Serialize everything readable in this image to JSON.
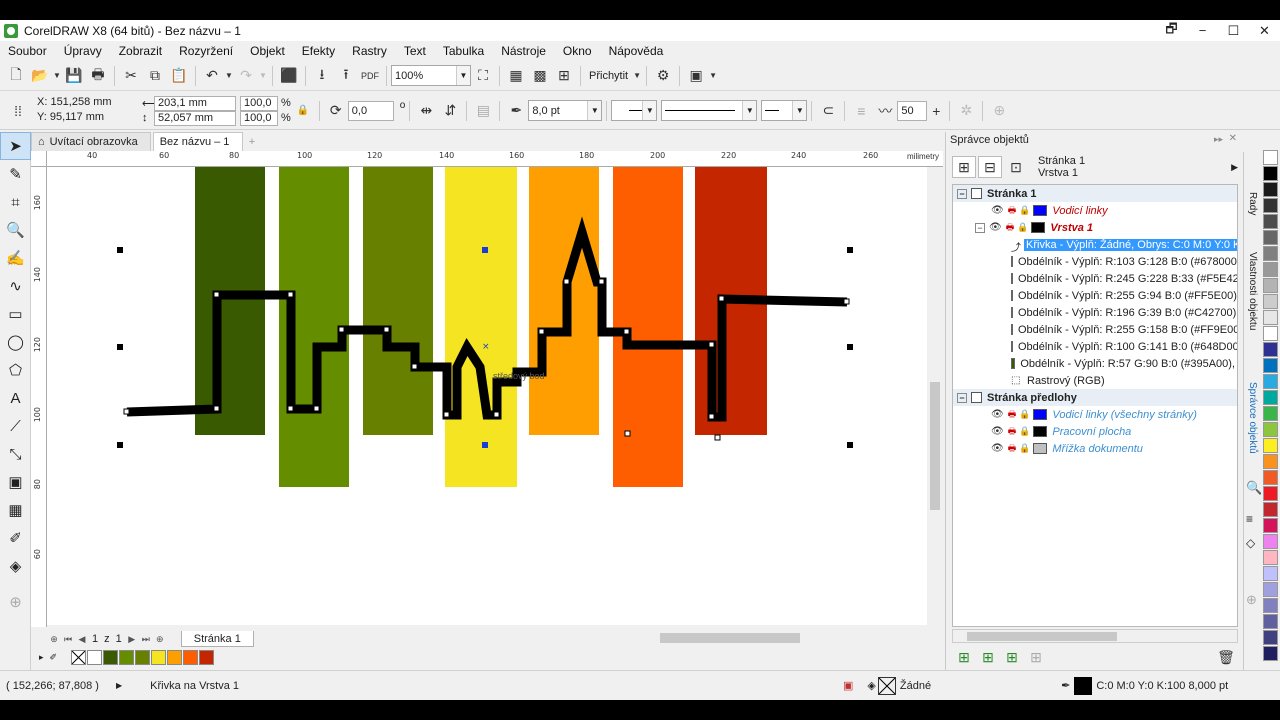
{
  "app": {
    "title": "CorelDRAW X8 (64 bitů) - Bez názvu – 1",
    "window_buttons": [
      "🗗",
      "−",
      "☐",
      "✕"
    ]
  },
  "menu": [
    "Soubor",
    "Úpravy",
    "Zobrazit",
    "Rozyržení",
    "Objekt",
    "Efekty",
    "Rastry",
    "Text",
    "Tabulka",
    "Nástroje",
    "Okno",
    "Nápověda"
  ],
  "toolbar1": {
    "zoom": "100%",
    "snap": "Přichytit",
    "pdf_label": "PDF"
  },
  "propbar": {
    "x": "X: 151,258 mm",
    "y": "Y: 95,117 mm",
    "w": "203,1 mm",
    "h": "52,057 mm",
    "sx": "100,0",
    "sy": "100,0",
    "pct": "%",
    "angle": "0,0",
    "deg": "o",
    "outline_width": "8,0 pt",
    "smooth": "50"
  },
  "tabs": {
    "welcome": "Uvítací obrazovka",
    "doc": "Bez názvu – 1",
    "add": "+"
  },
  "ruler": {
    "unit": "milimetry",
    "h_ticks": [
      "40",
      "60",
      "80",
      "100",
      "120",
      "140",
      "160",
      "180",
      "200",
      "220",
      "240",
      "260"
    ],
    "v_ticks": [
      "160",
      "140",
      "120",
      "100",
      "80",
      "60"
    ]
  },
  "canvas": {
    "node_label": "středový bod",
    "bars": [
      "#395A00",
      "#648D00",
      "#678000",
      "#F5E42",
      "#FF9E00",
      "#FF5E00",
      "#C42700"
    ]
  },
  "pagenav": {
    "current": "1",
    "of": "z",
    "total": "1",
    "tab": "Stránka 1"
  },
  "docpalette": [
    "#ffffff",
    "#395A00",
    "#648D00",
    "#678000",
    "#F5E421",
    "#FF9E00",
    "#FF5E00",
    "#C42700"
  ],
  "status": {
    "coords": "( 152,266; 87,808 )",
    "info": "Křivka na Vrstva 1",
    "fill": "Žádné",
    "outline": "C:0 M:0 Y:0 K:100  8,000 pt"
  },
  "docker": {
    "title": "Správce objektů",
    "page": "Stránka 1",
    "layer": "Vrstva 1",
    "tree": [
      {
        "level": 0,
        "type": "page",
        "text": "Stránka 1",
        "exp": "⊟"
      },
      {
        "level": 1,
        "type": "guides",
        "text": "Vodicí linky",
        "color": "#0000ff",
        "style": "ital red"
      },
      {
        "level": 1,
        "type": "layer",
        "text": "Vrstva 1",
        "color": "#000000",
        "style": "ital red bold",
        "exp": "⊟"
      },
      {
        "level": 2,
        "type": "curve",
        "text": "Křivka - Výplň: Žádné, Obrys: C:0 M:0 Y:0 K",
        "sel": true
      },
      {
        "level": 2,
        "type": "rect",
        "text": "Obdélník - Výplň: R:103 G:128 B:0 (#678000",
        "color": "#678000"
      },
      {
        "level": 2,
        "type": "rect",
        "text": "Obdélník - Výplň: R:245 G:228 B:33 (#F5E42",
        "color": "#F5E421"
      },
      {
        "level": 2,
        "type": "rect",
        "text": "Obdélník - Výplň: R:255 G:94 B:0 (#FF5E00),",
        "color": "#FF5E00"
      },
      {
        "level": 2,
        "type": "rect",
        "text": "Obdélník - Výplň: R:196 G:39 B:0 (#C42700)",
        "color": "#C42700"
      },
      {
        "level": 2,
        "type": "rect",
        "text": "Obdélník - Výplň: R:255 G:158 B:0 (#FF9E00",
        "color": "#FF9E00"
      },
      {
        "level": 2,
        "type": "rect",
        "text": "Obdélník - Výplň: R:100 G:141 B:0 (#648D00",
        "color": "#648D00"
      },
      {
        "level": 2,
        "type": "rect",
        "text": "Obdélník - Výplň: R:57 G:90 B:0 (#395A00),",
        "color": "#395A00"
      },
      {
        "level": 2,
        "type": "bitmap",
        "text": "Rastrový (RGB)"
      },
      {
        "level": 0,
        "type": "page",
        "text": "Stránka předlohy",
        "exp": "⊟"
      },
      {
        "level": 1,
        "type": "guides",
        "text": "Vodicí linky (všechny stránky)",
        "color": "#0000ff",
        "style": "ital blue"
      },
      {
        "level": 1,
        "type": "desk",
        "text": "Pracovní plocha",
        "color": "#000000",
        "style": "ital blue"
      },
      {
        "level": 1,
        "type": "grid",
        "text": "Mřížka dokumentu",
        "color": "#c0c0c0",
        "style": "ital blue"
      }
    ]
  },
  "sidetabs": [
    "Rady",
    "Vlastnosti objektu",
    "Správce objektů"
  ],
  "palette": [
    "#ffffff",
    "#000000",
    "#1a1a1a",
    "#333333",
    "#4d4d4d",
    "#666666",
    "#808080",
    "#999999",
    "#b3b3b3",
    "#cccccc",
    "#e6e6e6",
    "#ffffff",
    "#2e3192",
    "#0071bc",
    "#29abe2",
    "#00a99d",
    "#39b54a",
    "#8cc63f",
    "#fcee21",
    "#f7931e",
    "#f15a24",
    "#ed1c24",
    "#c1272d",
    "#d4145a",
    "#ee82ee",
    "#ffb6c1",
    "#c0c0ff",
    "#a0a0e0",
    "#8080c0",
    "#6060a0",
    "#404080",
    "#202060"
  ]
}
